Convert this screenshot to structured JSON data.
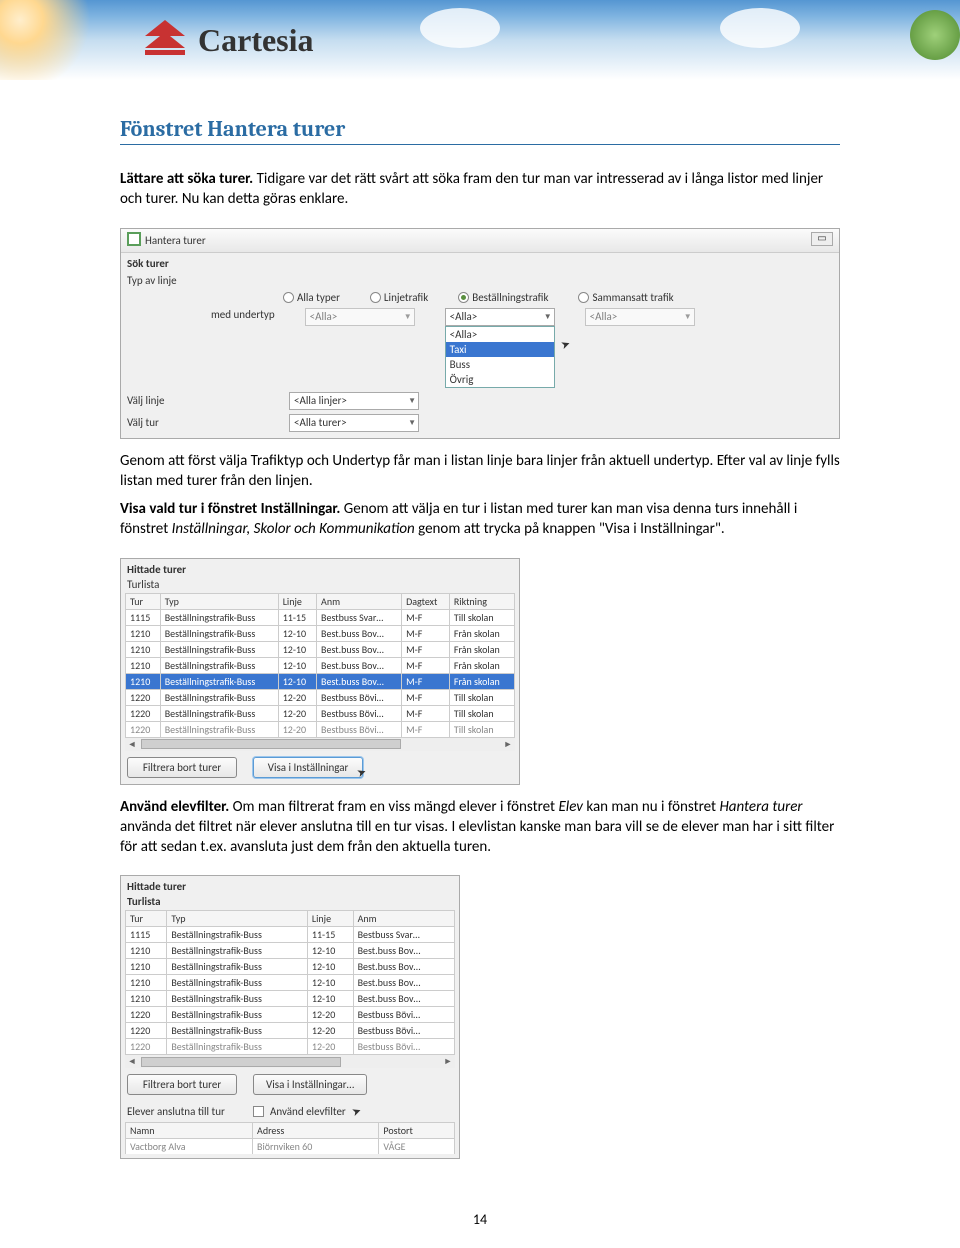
{
  "header": {
    "brand": "Cartesia"
  },
  "title": "Fönstret Hantera turer",
  "p1_bold": "Lättare att söka turer.",
  "p1_rest": " Tidigare var det rätt svårt att söka fram den tur man var intresserad av i långa listor med linjer och turer. Nu kan detta göras enklare.",
  "win1": {
    "title": "Hantera turer",
    "group": "Sök turer",
    "row_type_label": "Typ av linje",
    "radios": [
      "Alla typer",
      "Linjetrafik",
      "Beställningstrafik",
      "Sammansatt trafik"
    ],
    "radio_selected": 2,
    "undertype_label": "med undertyp",
    "cb1": "<Alla>",
    "cb2_sel": "<Alla>",
    "cb3": "<Alla>",
    "dd_items": [
      "<Alla>",
      "Taxi",
      "Buss",
      "Övrig"
    ],
    "dd_hl": 1,
    "row_linje_label": "Välj linje",
    "cb_linje": "<Alla linjer>",
    "row_tur_label": "Välj tur",
    "cb_tur": "<Alla turer>"
  },
  "p2": "Genom att först välja Trafiktyp och Undertyp får man i listan linje bara linjer från aktuell undertyp. Efter val av linje fylls listan med turer från den linjen.",
  "p3_bold": "Visa vald tur i fönstret Inställningar.",
  "p3_rest": " Genom att välja en tur i listan med turer kan man visa denna turs innehåll i fönstret ",
  "p3_it": "Inställningar, Skolor och Kommunikation",
  "p3_end": " genom att trycka på knappen \"Visa i Inställningar\".",
  "win2": {
    "group1": "Hittade turer",
    "group2": "Turlista",
    "cols": [
      "Tur",
      "Typ",
      "Linje",
      "Anm",
      "Dagtext",
      "Riktning"
    ],
    "rows": [
      [
        "1115",
        "Beställningstrafik-Buss",
        "11-15",
        "Bestbuss Svar…",
        "M-F",
        "Till skolan"
      ],
      [
        "1210",
        "Beställningstrafik-Buss",
        "12-10",
        "Best.buss Bov…",
        "M-F",
        "Från skolan"
      ],
      [
        "1210",
        "Beställningstrafik-Buss",
        "12-10",
        "Best.buss Bov…",
        "M-F",
        "Från skolan"
      ],
      [
        "1210",
        "Beställningstrafik-Buss",
        "12-10",
        "Best.buss Bov…",
        "M-F",
        "Från skolan"
      ],
      [
        "1210",
        "Beställningstrafik-Buss",
        "12-10",
        "Best.buss Bov…",
        "M-F",
        "Från skolan"
      ],
      [
        "1220",
        "Beställningstrafik-Buss",
        "12-20",
        "Bestbuss Bövi…",
        "M-F",
        "Till skolan"
      ],
      [
        "1220",
        "Beställningstrafik-Buss",
        "12-20",
        "Bestbuss Bövi…",
        "M-F",
        "Till skolan"
      ],
      [
        "1220",
        "Beställningstrafik-Buss",
        "12-20",
        "Bestbuss Bövi…",
        "M-F",
        "Till skolan"
      ]
    ],
    "hl_row": 4,
    "btn1": "Filtrera bort turer",
    "btn2": "Visa i Inställningar"
  },
  "p4_bold": "Använd elevfilter.",
  "p4_a": " Om man filtrerat fram en viss mängd elever i fönstret ",
  "p4_it1": "Elev",
  "p4_b": " kan man nu i fönstret ",
  "p4_it2": "Hantera turer",
  "p4_c": " använda det filtret när elever anslutna till en tur visas. I elevlistan kanske man bara vill se de elever man har i sitt filter för att sedan t.ex. avansluta just dem från den aktuella turen.",
  "win3": {
    "group1": "Hittade turer",
    "group2": "Turlista",
    "cols": [
      "Tur",
      "Typ",
      "Linje",
      "Anm"
    ],
    "rows": [
      [
        "1115",
        "Beställningstrafik-Buss",
        "11-15",
        "Bestbuss Svar…"
      ],
      [
        "1210",
        "Beställningstrafik-Buss",
        "12-10",
        "Best.buss Bov…"
      ],
      [
        "1210",
        "Beställningstrafik-Buss",
        "12-10",
        "Best.buss Bov…"
      ],
      [
        "1210",
        "Beställningstrafik-Buss",
        "12-10",
        "Best.buss Bov…"
      ],
      [
        "1210",
        "Beställningstrafik-Buss",
        "12-10",
        "Best.buss Bov…"
      ],
      [
        "1220",
        "Beställningstrafik-Buss",
        "12-20",
        "Bestbuss Bövi…"
      ],
      [
        "1220",
        "Beställningstrafik-Buss",
        "12-20",
        "Bestbuss Bövi…"
      ],
      [
        "1220",
        "Beställningstrafik-Buss",
        "12-20",
        "Bestbuss Bövi…"
      ]
    ],
    "btn1": "Filtrera bort turer",
    "btn2": "Visa i Inställningar…",
    "elev_label": "Elever anslutna till tur",
    "chk_label": "Använd elevfilter",
    "cols2": [
      "Namn",
      "Adress",
      "Postort"
    ],
    "row2": [
      "Vactborg Alva",
      "Biörnviken 60",
      "VÅGE"
    ]
  },
  "page_no": "14"
}
